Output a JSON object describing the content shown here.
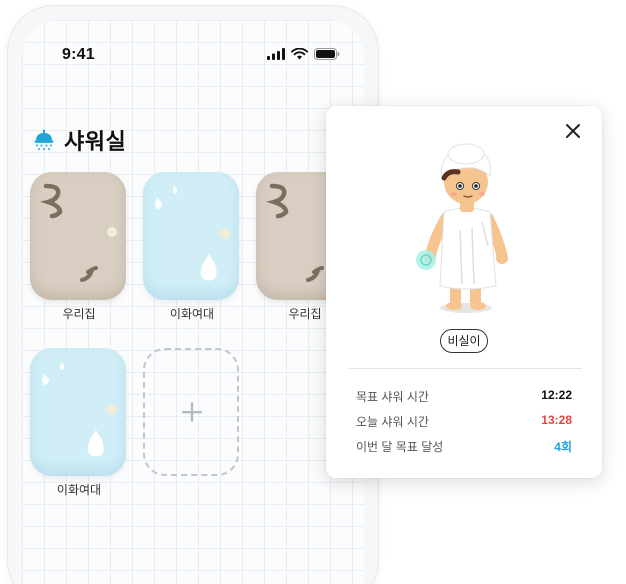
{
  "status_bar": {
    "time": "9:41"
  },
  "header": {
    "title": "샤워실",
    "icon": "shower-icon"
  },
  "rooms": [
    {
      "label": "우리집",
      "style": "towel"
    },
    {
      "label": "이화여대",
      "style": "water"
    },
    {
      "label": "우리집",
      "style": "towel"
    },
    {
      "label": "이화여대",
      "style": "water"
    }
  ],
  "add_room": {
    "icon": "plus-icon"
  },
  "detail_card": {
    "status": "비실이",
    "stats": [
      {
        "label": "목표 샤워 시간",
        "value": "12:22",
        "color": "#111111"
      },
      {
        "label": "오늘 샤워 시간",
        "value": "13:28",
        "color": "#e84343"
      },
      {
        "label": "이번 달 목표 달성",
        "value": "4회",
        "color": "#1fa6d6"
      }
    ]
  },
  "colors": {
    "towel": "#d9cec2",
    "water": "#d1eef7",
    "accent": "#1fa6d6",
    "alert": "#e84343"
  }
}
